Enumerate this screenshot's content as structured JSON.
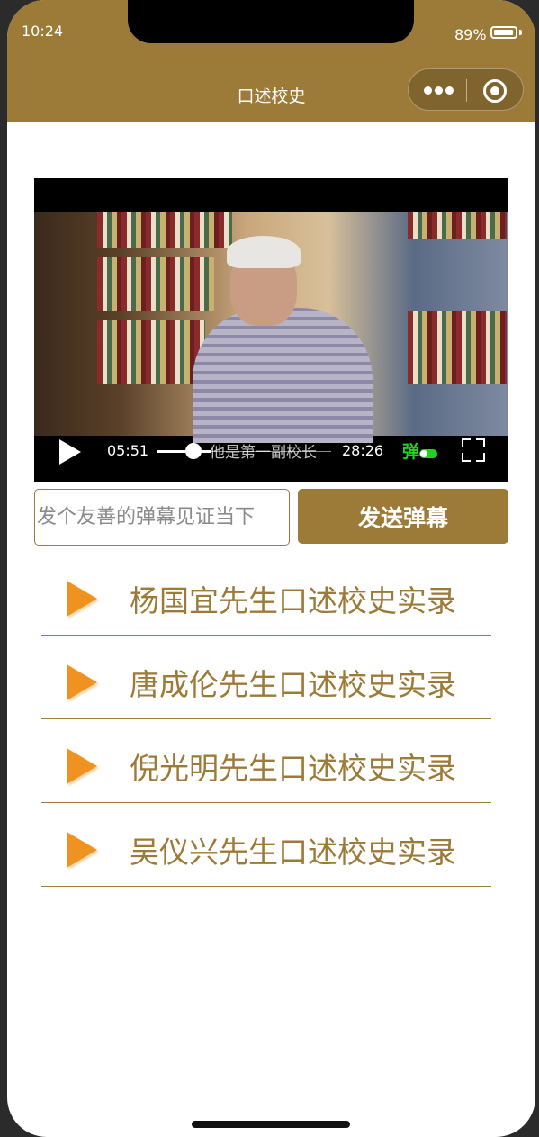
{
  "status_bar": {
    "time": "10:24",
    "battery": "89%"
  },
  "nav": {
    "title": "口述校史"
  },
  "video": {
    "current_time": "05:51",
    "total_time": "28:26",
    "danmu_text": "他是第一副校长",
    "danmu_toggle_label": "弹"
  },
  "danmu_form": {
    "placeholder": "发个友善的弹幕见证当下",
    "send_label": "发送弹幕"
  },
  "list": {
    "items": [
      {
        "label": "杨国宜先生口述校史实录"
      },
      {
        "label": "唐成伦先生口述校史实录"
      },
      {
        "label": "倪光明先生口述校史实录"
      },
      {
        "label": "吴仪兴先生口述校史实录"
      }
    ]
  },
  "colors": {
    "brand": "#9c7a38",
    "arrow": "#f0921f",
    "danmu_green": "#1fd31f"
  }
}
